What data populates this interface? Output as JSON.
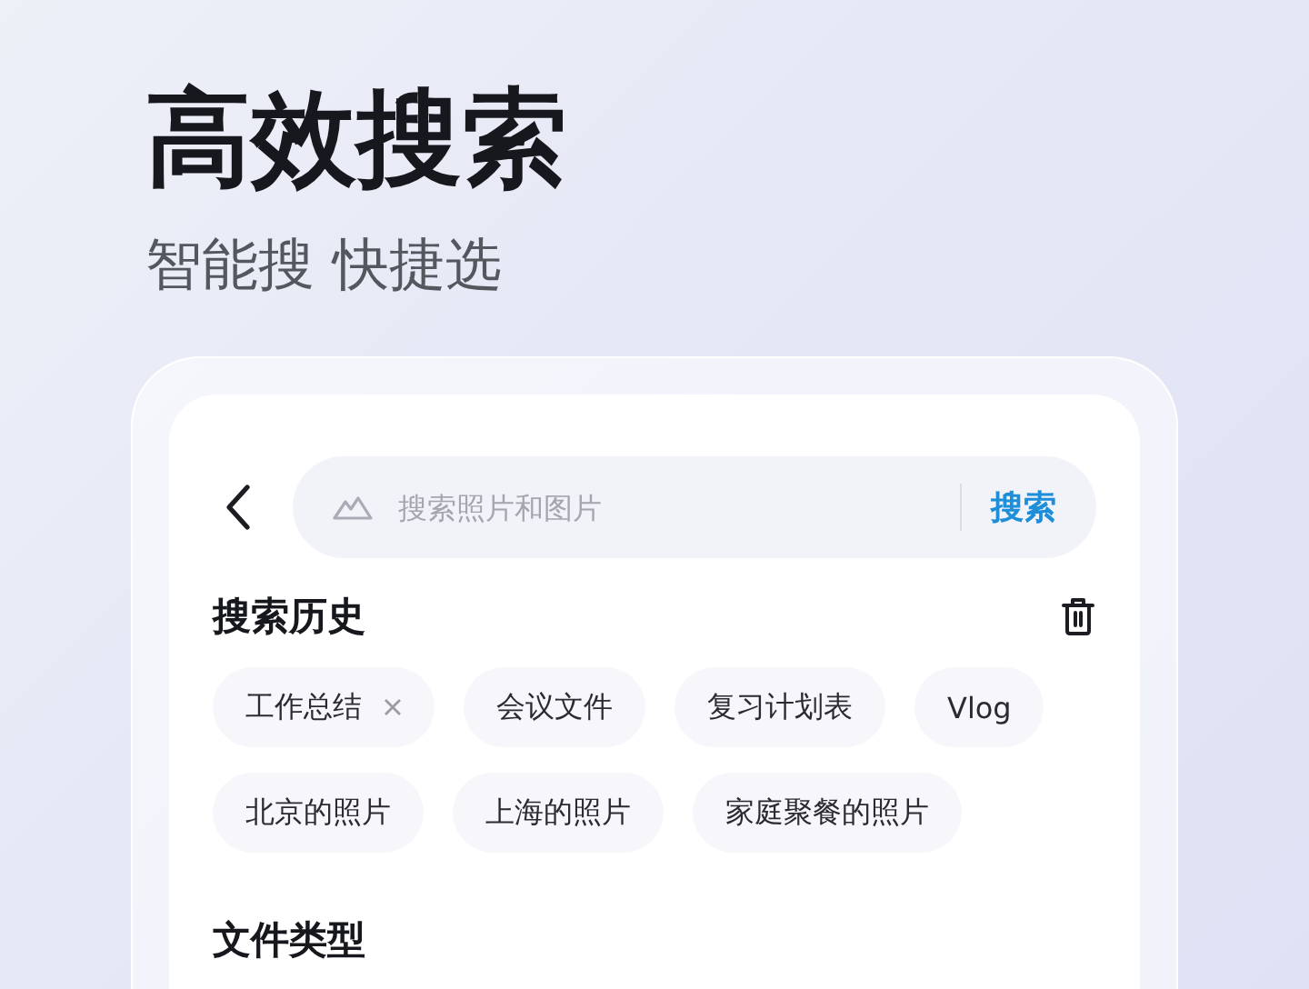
{
  "headline": {
    "title": "高效搜索",
    "subtitle": "智能搜 快捷选"
  },
  "search": {
    "placeholder": "搜索照片和图片",
    "button": "搜索"
  },
  "history": {
    "title": "搜索历史",
    "chips": [
      {
        "label": "工作总结",
        "removable": true
      },
      {
        "label": "会议文件",
        "removable": false
      },
      {
        "label": "复习计划表",
        "removable": false
      },
      {
        "label": "Vlog",
        "removable": false
      },
      {
        "label": "北京的照片",
        "removable": false
      },
      {
        "label": "上海的照片",
        "removable": false
      },
      {
        "label": "家庭聚餐的照片",
        "removable": false
      }
    ]
  },
  "file_types": {
    "title": "文件类型"
  }
}
